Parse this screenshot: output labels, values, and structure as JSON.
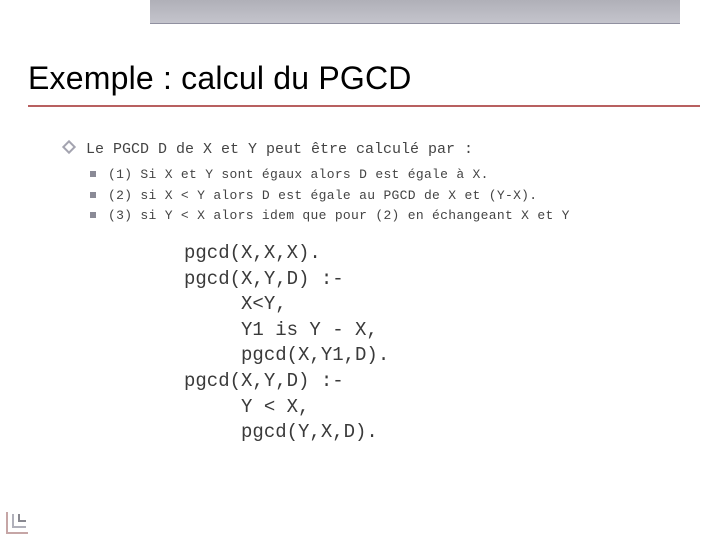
{
  "title": "Exemple : calcul du PGCD",
  "main_bullet": "Le PGCD D de X et Y peut être calculé par :",
  "sub_bullets": [
    "(1) Si X et Y sont égaux alors D est égale à X.",
    "(2) si X < Y alors D est égale au PGCD  de X et (Y-X).",
    "(3) si Y < X alors idem que pour (2) en échangeant X et Y"
  ],
  "code": "pgcd(X,X,X).\npgcd(X,Y,D) :-\n     X<Y,\n     Y1 is Y - X,\n     pgcd(X,Y1,D).\npgcd(X,Y,D) :-\n     Y < X,\n     pgcd(Y,X,D)."
}
